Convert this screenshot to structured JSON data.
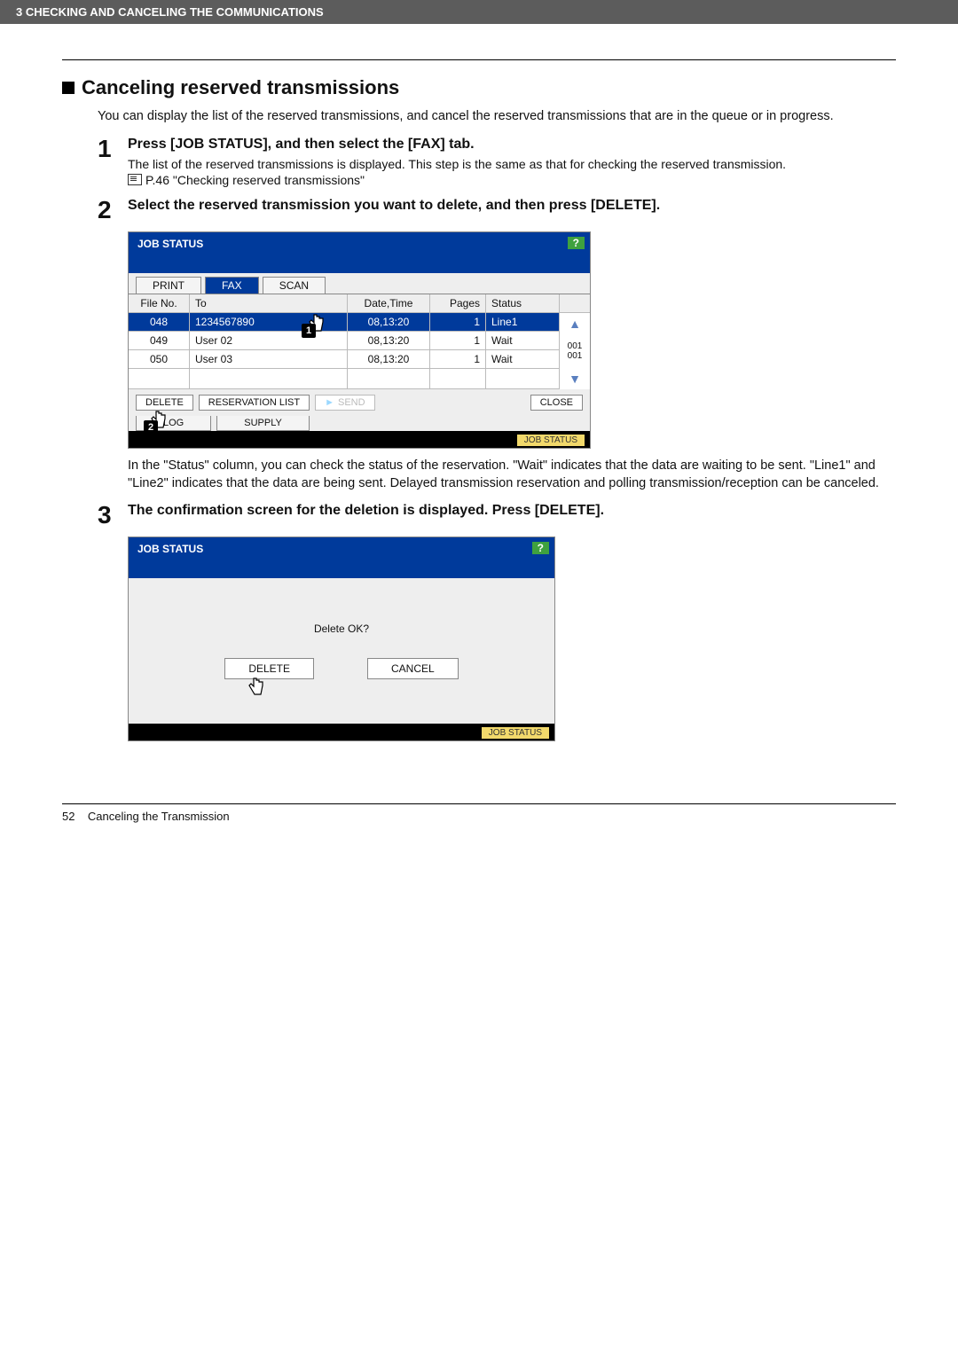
{
  "header": {
    "breadcrumb": "3 CHECKING AND CANCELING THE COMMUNICATIONS"
  },
  "section": {
    "title": "Canceling reserved transmissions",
    "intro": "You can display the list of the reserved transmissions, and cancel the reserved transmissions that are in the queue or in progress."
  },
  "steps": {
    "s1": {
      "num": "1",
      "head": "Press [JOB STATUS], and then select the [FAX] tab.",
      "body": "The list of the reserved transmissions is displayed. This step is the same as that for checking the reserved transmission.",
      "ref": "P.46 \"Checking reserved transmissions\""
    },
    "s2": {
      "num": "2",
      "head": "Select the reserved transmission you want to delete, and then press [DELETE].",
      "after": "In the \"Status\" column, you can check the status of the reservation. \"Wait\" indicates that the data are waiting to be sent. \"Line1\" and \"Line2\" indicates that the data are being sent. Delayed transmission reservation and polling transmission/reception can be canceled."
    },
    "s3": {
      "num": "3",
      "head": "The confirmation screen for the deletion is displayed. Press [DELETE]."
    }
  },
  "shot1": {
    "title": "JOB STATUS",
    "help": "?",
    "tabs": {
      "print": "PRINT",
      "fax": "FAX",
      "scan": "SCAN"
    },
    "cols": {
      "file": "File No.",
      "to": "To",
      "dt": "Date,Time",
      "pg": "Pages",
      "st": "Status"
    },
    "rows": [
      {
        "file": "048",
        "to": "1234567890",
        "dt": "08,13:20",
        "pg": "1",
        "st": "Line1"
      },
      {
        "file": "049",
        "to": "User 02",
        "dt": "08,13:20",
        "pg": "1",
        "st": "Wait"
      },
      {
        "file": "050",
        "to": "User 03",
        "dt": "08,13:20",
        "pg": "1",
        "st": "Wait"
      }
    ],
    "page_ind": "001\n001",
    "buttons": {
      "delete": "DELETE",
      "reslist": "RESERVATION LIST",
      "send": "SEND",
      "close": "CLOSE"
    },
    "bottom_tabs": {
      "log": "LOG",
      "supply": "SUPPLY"
    },
    "jobstatus": "JOB STATUS",
    "pointer1": "1",
    "pointer2": "2"
  },
  "shot2": {
    "title": "JOB STATUS",
    "help": "?",
    "msg": "Delete OK?",
    "delete": "DELETE",
    "cancel": "CANCEL",
    "jobstatus": "JOB STATUS"
  },
  "footer": {
    "page": "52",
    "label": "Canceling the Transmission"
  }
}
